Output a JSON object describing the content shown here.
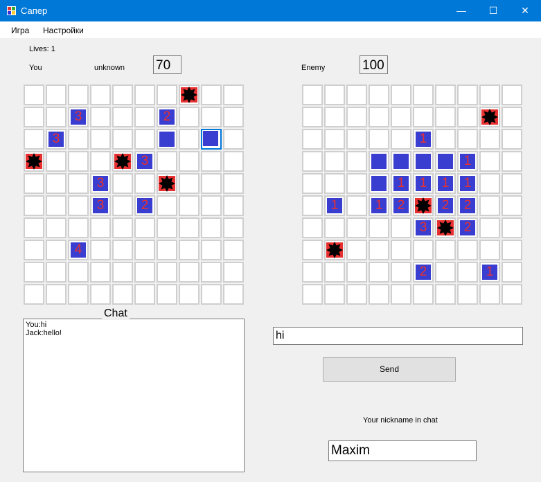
{
  "window": {
    "title": "Сапер",
    "min_glyph": "—",
    "max_glyph": "☐",
    "close_glyph": "✕"
  },
  "menu": {
    "items": [
      "Игра",
      "Настройки"
    ]
  },
  "status": {
    "lives_label": "Lives: 1",
    "you_label": "You",
    "unknown_label": "unknown",
    "you_score": "70",
    "enemy_label": "Enemy",
    "enemy_score": "100"
  },
  "you_board": [
    [
      ".",
      ".",
      ".",
      ".",
      ".",
      ".",
      ".",
      "*",
      ".",
      "."
    ],
    [
      ".",
      ".",
      "3",
      ".",
      ".",
      ".",
      "2",
      ".",
      ".",
      "."
    ],
    [
      ".",
      "3",
      ".",
      ".",
      ".",
      ".",
      "#",
      ".",
      "S",
      "."
    ],
    [
      "*",
      ".",
      ".",
      ".",
      "*",
      "3",
      ".",
      ".",
      ".",
      "."
    ],
    [
      ".",
      ".",
      ".",
      "3",
      ".",
      ".",
      "*",
      ".",
      ".",
      "."
    ],
    [
      ".",
      ".",
      ".",
      "3",
      ".",
      "2",
      ".",
      ".",
      ".",
      "."
    ],
    [
      ".",
      ".",
      ".",
      ".",
      ".",
      ".",
      ".",
      ".",
      ".",
      "."
    ],
    [
      ".",
      ".",
      "4",
      ".",
      ".",
      ".",
      ".",
      ".",
      ".",
      "."
    ],
    [
      ".",
      ".",
      ".",
      ".",
      ".",
      ".",
      ".",
      ".",
      ".",
      "."
    ],
    [
      ".",
      ".",
      ".",
      ".",
      ".",
      ".",
      ".",
      ".",
      ".",
      "."
    ]
  ],
  "enemy_board": [
    [
      ".",
      ".",
      ".",
      ".",
      ".",
      ".",
      ".",
      ".",
      ".",
      "."
    ],
    [
      ".",
      ".",
      ".",
      ".",
      ".",
      ".",
      ".",
      ".",
      "*",
      "."
    ],
    [
      ".",
      ".",
      ".",
      ".",
      ".",
      "1",
      ".",
      ".",
      ".",
      "."
    ],
    [
      ".",
      ".",
      ".",
      "#",
      "#",
      "#",
      "#",
      "1",
      ".",
      "."
    ],
    [
      ".",
      ".",
      ".",
      "#",
      "1",
      "1",
      "1",
      "1",
      ".",
      "."
    ],
    [
      ".",
      "1",
      ".",
      "1",
      "2",
      "*",
      "2",
      "2",
      ".",
      "."
    ],
    [
      ".",
      ".",
      ".",
      ".",
      ".",
      "3",
      "*",
      "2",
      ".",
      "."
    ],
    [
      ".",
      "*",
      ".",
      ".",
      ".",
      ".",
      ".",
      ".",
      ".",
      "."
    ],
    [
      ".",
      ".",
      ".",
      ".",
      ".",
      "2",
      ".",
      ".",
      "1",
      "."
    ],
    [
      ".",
      ".",
      ".",
      ".",
      ".",
      ".",
      ".",
      ".",
      ".",
      "."
    ]
  ],
  "chat": {
    "legend": "Chat",
    "messages": [
      "You:hi",
      "Jack:hello!"
    ],
    "input_value": "hi",
    "send_label": "Send",
    "nickname_label": "Your nickname in chat",
    "nickname_value": "Maxim"
  },
  "colors": {
    "titlebar": "#0078d7",
    "tile": "#3a3ed0",
    "digit": "#e83030",
    "mine": "#000000",
    "mine_flag": "#e83030"
  }
}
